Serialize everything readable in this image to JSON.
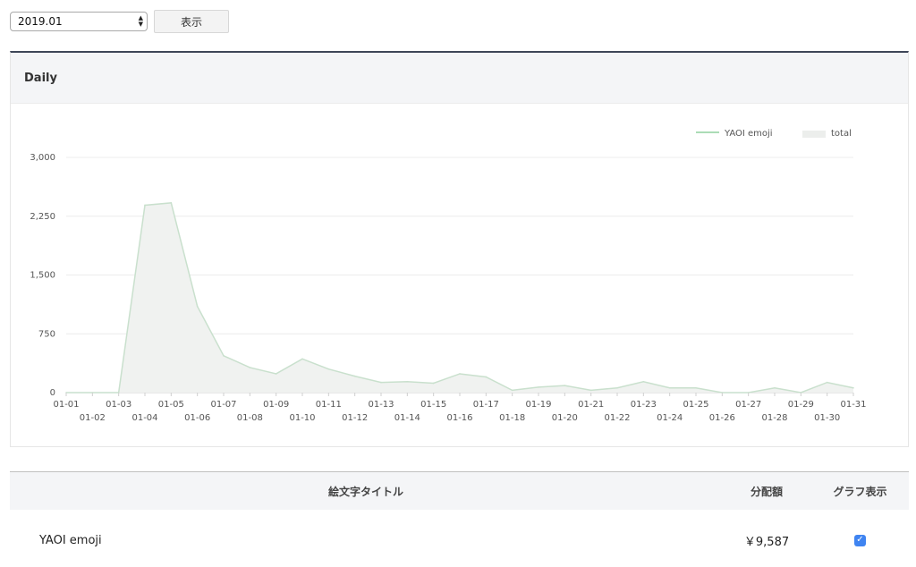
{
  "controls": {
    "selected_month": "2019.01",
    "show_button_label": "表示"
  },
  "panel": {
    "title": "Daily"
  },
  "chart_data": {
    "type": "area",
    "title": "",
    "xlabel": "",
    "ylabel": "",
    "ylim": [
      0,
      3000
    ],
    "y_ticks": [
      "0",
      "750",
      "1,500",
      "2,250",
      "3,000"
    ],
    "y_tick_values": [
      0,
      750,
      1500,
      2250,
      3000
    ],
    "grid": true,
    "legend_position": "top-right",
    "categories": [
      "01-01",
      "01-02",
      "01-03",
      "01-04",
      "01-05",
      "01-06",
      "01-07",
      "01-08",
      "01-09",
      "01-10",
      "01-11",
      "01-12",
      "01-13",
      "01-14",
      "01-15",
      "01-16",
      "01-17",
      "01-18",
      "01-19",
      "01-20",
      "01-21",
      "01-22",
      "01-23",
      "01-24",
      "01-25",
      "01-26",
      "01-27",
      "01-28",
      "01-29",
      "01-30",
      "01-31"
    ],
    "series": [
      {
        "name": "YAOI emoji",
        "kind": "line",
        "color": "#8fd19e",
        "values": [
          0,
          0,
          0,
          2390,
          2420,
          1100,
          470,
          320,
          240,
          430,
          300,
          210,
          130,
          140,
          120,
          240,
          200,
          30,
          70,
          90,
          30,
          60,
          140,
          60,
          60,
          0,
          0,
          60,
          0,
          130,
          60
        ]
      },
      {
        "name": "total",
        "kind": "area",
        "color": "#f0f2f0",
        "values": [
          0,
          0,
          0,
          2390,
          2420,
          1100,
          470,
          320,
          240,
          430,
          300,
          210,
          130,
          140,
          120,
          240,
          200,
          30,
          70,
          90,
          30,
          60,
          140,
          60,
          60,
          0,
          0,
          60,
          0,
          130,
          60
        ]
      }
    ]
  },
  "table": {
    "headers": {
      "title": "絵文字タイトル",
      "amount": "分配額",
      "graph": "グラフ表示"
    },
    "rows": [
      {
        "title": "YAOI emoji",
        "amount": "￥9,587",
        "graph_checked": true
      }
    ]
  }
}
